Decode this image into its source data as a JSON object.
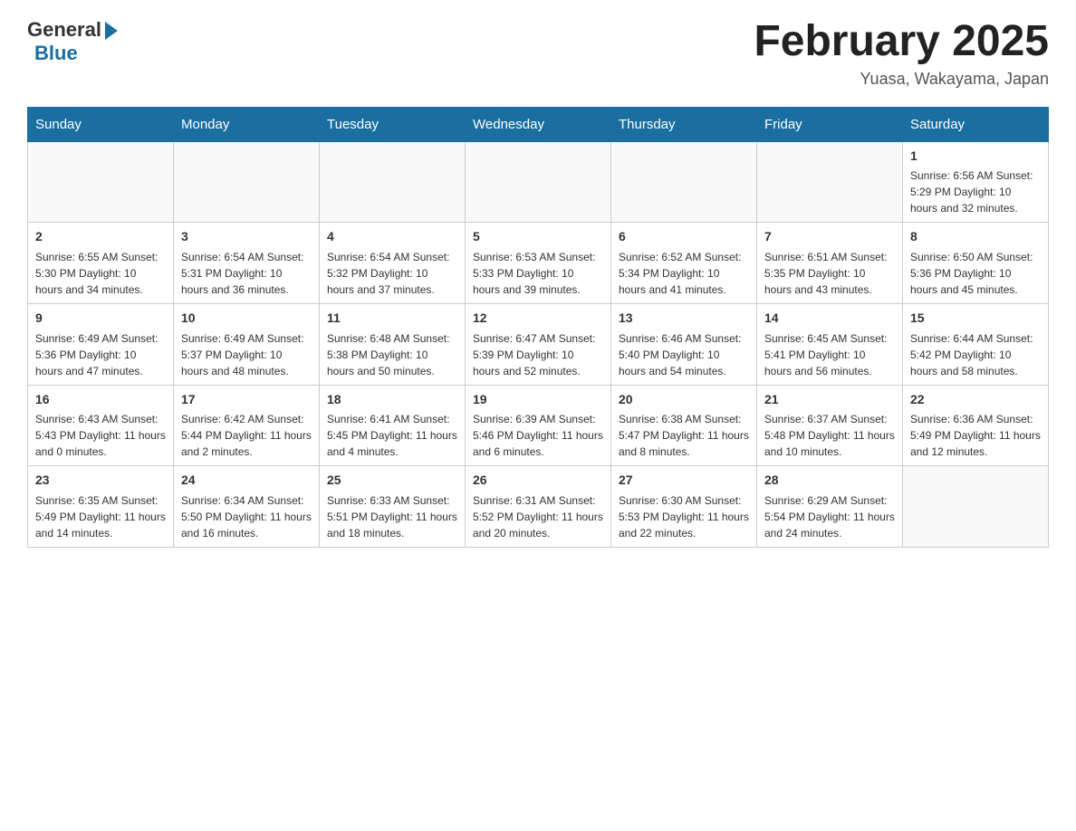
{
  "header": {
    "logo_general": "General",
    "logo_blue": "Blue",
    "title": "February 2025",
    "location": "Yuasa, Wakayama, Japan"
  },
  "weekdays": [
    "Sunday",
    "Monday",
    "Tuesday",
    "Wednesday",
    "Thursday",
    "Friday",
    "Saturday"
  ],
  "weeks": [
    [
      {
        "day": "",
        "info": ""
      },
      {
        "day": "",
        "info": ""
      },
      {
        "day": "",
        "info": ""
      },
      {
        "day": "",
        "info": ""
      },
      {
        "day": "",
        "info": ""
      },
      {
        "day": "",
        "info": ""
      },
      {
        "day": "1",
        "info": "Sunrise: 6:56 AM\nSunset: 5:29 PM\nDaylight: 10 hours and 32 minutes."
      }
    ],
    [
      {
        "day": "2",
        "info": "Sunrise: 6:55 AM\nSunset: 5:30 PM\nDaylight: 10 hours and 34 minutes."
      },
      {
        "day": "3",
        "info": "Sunrise: 6:54 AM\nSunset: 5:31 PM\nDaylight: 10 hours and 36 minutes."
      },
      {
        "day": "4",
        "info": "Sunrise: 6:54 AM\nSunset: 5:32 PM\nDaylight: 10 hours and 37 minutes."
      },
      {
        "day": "5",
        "info": "Sunrise: 6:53 AM\nSunset: 5:33 PM\nDaylight: 10 hours and 39 minutes."
      },
      {
        "day": "6",
        "info": "Sunrise: 6:52 AM\nSunset: 5:34 PM\nDaylight: 10 hours and 41 minutes."
      },
      {
        "day": "7",
        "info": "Sunrise: 6:51 AM\nSunset: 5:35 PM\nDaylight: 10 hours and 43 minutes."
      },
      {
        "day": "8",
        "info": "Sunrise: 6:50 AM\nSunset: 5:36 PM\nDaylight: 10 hours and 45 minutes."
      }
    ],
    [
      {
        "day": "9",
        "info": "Sunrise: 6:49 AM\nSunset: 5:36 PM\nDaylight: 10 hours and 47 minutes."
      },
      {
        "day": "10",
        "info": "Sunrise: 6:49 AM\nSunset: 5:37 PM\nDaylight: 10 hours and 48 minutes."
      },
      {
        "day": "11",
        "info": "Sunrise: 6:48 AM\nSunset: 5:38 PM\nDaylight: 10 hours and 50 minutes."
      },
      {
        "day": "12",
        "info": "Sunrise: 6:47 AM\nSunset: 5:39 PM\nDaylight: 10 hours and 52 minutes."
      },
      {
        "day": "13",
        "info": "Sunrise: 6:46 AM\nSunset: 5:40 PM\nDaylight: 10 hours and 54 minutes."
      },
      {
        "day": "14",
        "info": "Sunrise: 6:45 AM\nSunset: 5:41 PM\nDaylight: 10 hours and 56 minutes."
      },
      {
        "day": "15",
        "info": "Sunrise: 6:44 AM\nSunset: 5:42 PM\nDaylight: 10 hours and 58 minutes."
      }
    ],
    [
      {
        "day": "16",
        "info": "Sunrise: 6:43 AM\nSunset: 5:43 PM\nDaylight: 11 hours and 0 minutes."
      },
      {
        "day": "17",
        "info": "Sunrise: 6:42 AM\nSunset: 5:44 PM\nDaylight: 11 hours and 2 minutes."
      },
      {
        "day": "18",
        "info": "Sunrise: 6:41 AM\nSunset: 5:45 PM\nDaylight: 11 hours and 4 minutes."
      },
      {
        "day": "19",
        "info": "Sunrise: 6:39 AM\nSunset: 5:46 PM\nDaylight: 11 hours and 6 minutes."
      },
      {
        "day": "20",
        "info": "Sunrise: 6:38 AM\nSunset: 5:47 PM\nDaylight: 11 hours and 8 minutes."
      },
      {
        "day": "21",
        "info": "Sunrise: 6:37 AM\nSunset: 5:48 PM\nDaylight: 11 hours and 10 minutes."
      },
      {
        "day": "22",
        "info": "Sunrise: 6:36 AM\nSunset: 5:49 PM\nDaylight: 11 hours and 12 minutes."
      }
    ],
    [
      {
        "day": "23",
        "info": "Sunrise: 6:35 AM\nSunset: 5:49 PM\nDaylight: 11 hours and 14 minutes."
      },
      {
        "day": "24",
        "info": "Sunrise: 6:34 AM\nSunset: 5:50 PM\nDaylight: 11 hours and 16 minutes."
      },
      {
        "day": "25",
        "info": "Sunrise: 6:33 AM\nSunset: 5:51 PM\nDaylight: 11 hours and 18 minutes."
      },
      {
        "day": "26",
        "info": "Sunrise: 6:31 AM\nSunset: 5:52 PM\nDaylight: 11 hours and 20 minutes."
      },
      {
        "day": "27",
        "info": "Sunrise: 6:30 AM\nSunset: 5:53 PM\nDaylight: 11 hours and 22 minutes."
      },
      {
        "day": "28",
        "info": "Sunrise: 6:29 AM\nSunset: 5:54 PM\nDaylight: 11 hours and 24 minutes."
      },
      {
        "day": "",
        "info": ""
      }
    ]
  ]
}
